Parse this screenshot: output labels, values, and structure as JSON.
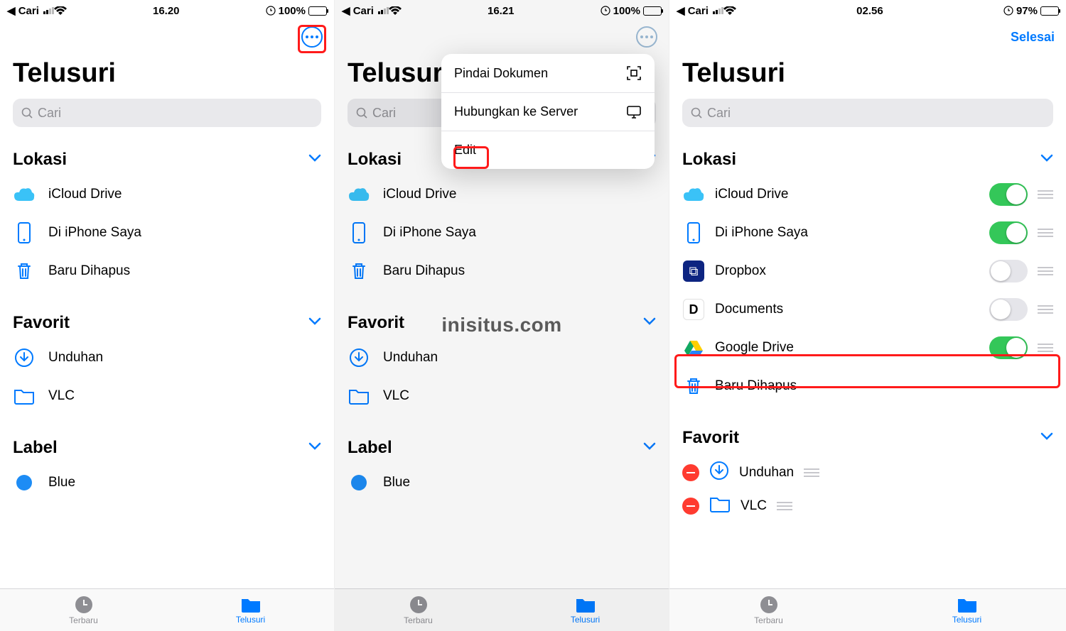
{
  "watermark": "inisitus.com",
  "screens": [
    {
      "status": {
        "back": "Cari",
        "time": "16.20",
        "battery": "100%"
      },
      "title": "Telusuri",
      "search_placeholder": "Cari",
      "done_label": null,
      "sections": {
        "lokasi": {
          "header": "Lokasi",
          "items": [
            "iCloud Drive",
            "Di iPhone Saya",
            "Baru Dihapus"
          ]
        },
        "favorit": {
          "header": "Favorit",
          "items": [
            "Unduhan",
            "VLC"
          ]
        },
        "label": {
          "header": "Label",
          "items": [
            "Blue"
          ]
        }
      },
      "tabs": {
        "recent": "Terbaru",
        "browse": "Telusuri"
      }
    },
    {
      "status": {
        "back": "Cari",
        "time": "16.21",
        "battery": "100%"
      },
      "title": "Telusuri",
      "search_placeholder": "Cari",
      "menu": {
        "scan": "Pindai Dokumen",
        "server": "Hubungkan ke Server",
        "edit": "Edit"
      },
      "sections": {
        "lokasi": {
          "header": "Lokasi",
          "items": [
            "iCloud Drive",
            "Di iPhone Saya",
            "Baru Dihapus"
          ]
        },
        "favorit": {
          "header": "Favorit",
          "items": [
            "Unduhan",
            "VLC"
          ]
        },
        "label": {
          "header": "Label",
          "items": [
            "Blue"
          ]
        }
      },
      "tabs": {
        "recent": "Terbaru",
        "browse": "Telusuri"
      }
    },
    {
      "status": {
        "back": "Cari",
        "time": "02.56",
        "battery": "97%"
      },
      "title": "Telusuri",
      "search_placeholder": "Cari",
      "done_label": "Selesai",
      "sections": {
        "lokasi": {
          "header": "Lokasi",
          "items": [
            {
              "label": "iCloud Drive",
              "on": true
            },
            {
              "label": "Di iPhone Saya",
              "on": true
            },
            {
              "label": "Dropbox",
              "on": false
            },
            {
              "label": "Documents",
              "on": false
            },
            {
              "label": "Google Drive",
              "on": true
            },
            {
              "label": "Baru Dihapus",
              "on": null
            }
          ]
        },
        "favorit": {
          "header": "Favorit",
          "items": [
            "Unduhan",
            "VLC"
          ]
        }
      },
      "tabs": {
        "recent": "Terbaru",
        "browse": "Telusuri"
      }
    }
  ]
}
